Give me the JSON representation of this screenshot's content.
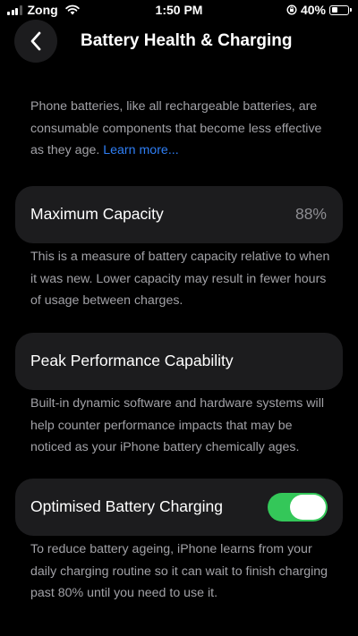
{
  "status_bar": {
    "carrier": "Zong",
    "time": "1:50 PM",
    "battery_percent": "40%",
    "battery_level": 0.4
  },
  "header": {
    "title": "Battery Health & Charging"
  },
  "intro": {
    "text": "Phone batteries, like all rechargeable batteries, are consumable components that become less effective as they age.",
    "link": "Learn more..."
  },
  "maximum_capacity": {
    "label": "Maximum Capacity",
    "value": "88%",
    "description": "This is a measure of battery capacity relative to when it was new. Lower capacity may result in fewer hours of usage between charges."
  },
  "peak_performance": {
    "label": "Peak Performance Capability",
    "description": "Built-in dynamic software and hardware systems will help counter performance impacts that may be noticed as your iPhone battery chemically ages."
  },
  "optimised_charging": {
    "label": "Optimised Battery Charging",
    "enabled": true,
    "toggle_color": "#34c759",
    "description": "To reduce battery ageing, iPhone learns from your daily charging routine so it can wait to finish charging past 80% until you need to use it."
  },
  "colors": {
    "background": "#000000",
    "card": "#1c1c1e",
    "secondary_text": "#a1a1a6",
    "link": "#2f7ff6"
  }
}
